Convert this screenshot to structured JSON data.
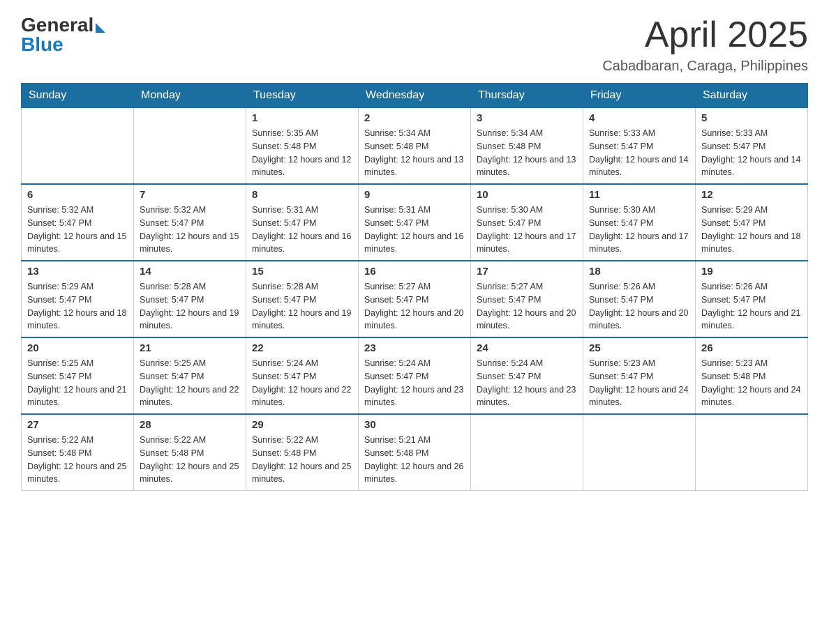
{
  "header": {
    "logo_general": "General",
    "logo_blue": "Blue",
    "month_title": "April 2025",
    "location": "Cabadbaran, Caraga, Philippines"
  },
  "columns": [
    "Sunday",
    "Monday",
    "Tuesday",
    "Wednesday",
    "Thursday",
    "Friday",
    "Saturday"
  ],
  "weeks": [
    [
      {
        "day": "",
        "sunrise": "",
        "sunset": "",
        "daylight": ""
      },
      {
        "day": "",
        "sunrise": "",
        "sunset": "",
        "daylight": ""
      },
      {
        "day": "1",
        "sunrise": "Sunrise: 5:35 AM",
        "sunset": "Sunset: 5:48 PM",
        "daylight": "Daylight: 12 hours and 12 minutes."
      },
      {
        "day": "2",
        "sunrise": "Sunrise: 5:34 AM",
        "sunset": "Sunset: 5:48 PM",
        "daylight": "Daylight: 12 hours and 13 minutes."
      },
      {
        "day": "3",
        "sunrise": "Sunrise: 5:34 AM",
        "sunset": "Sunset: 5:48 PM",
        "daylight": "Daylight: 12 hours and 13 minutes."
      },
      {
        "day": "4",
        "sunrise": "Sunrise: 5:33 AM",
        "sunset": "Sunset: 5:47 PM",
        "daylight": "Daylight: 12 hours and 14 minutes."
      },
      {
        "day": "5",
        "sunrise": "Sunrise: 5:33 AM",
        "sunset": "Sunset: 5:47 PM",
        "daylight": "Daylight: 12 hours and 14 minutes."
      }
    ],
    [
      {
        "day": "6",
        "sunrise": "Sunrise: 5:32 AM",
        "sunset": "Sunset: 5:47 PM",
        "daylight": "Daylight: 12 hours and 15 minutes."
      },
      {
        "day": "7",
        "sunrise": "Sunrise: 5:32 AM",
        "sunset": "Sunset: 5:47 PM",
        "daylight": "Daylight: 12 hours and 15 minutes."
      },
      {
        "day": "8",
        "sunrise": "Sunrise: 5:31 AM",
        "sunset": "Sunset: 5:47 PM",
        "daylight": "Daylight: 12 hours and 16 minutes."
      },
      {
        "day": "9",
        "sunrise": "Sunrise: 5:31 AM",
        "sunset": "Sunset: 5:47 PM",
        "daylight": "Daylight: 12 hours and 16 minutes."
      },
      {
        "day": "10",
        "sunrise": "Sunrise: 5:30 AM",
        "sunset": "Sunset: 5:47 PM",
        "daylight": "Daylight: 12 hours and 17 minutes."
      },
      {
        "day": "11",
        "sunrise": "Sunrise: 5:30 AM",
        "sunset": "Sunset: 5:47 PM",
        "daylight": "Daylight: 12 hours and 17 minutes."
      },
      {
        "day": "12",
        "sunrise": "Sunrise: 5:29 AM",
        "sunset": "Sunset: 5:47 PM",
        "daylight": "Daylight: 12 hours and 18 minutes."
      }
    ],
    [
      {
        "day": "13",
        "sunrise": "Sunrise: 5:29 AM",
        "sunset": "Sunset: 5:47 PM",
        "daylight": "Daylight: 12 hours and 18 minutes."
      },
      {
        "day": "14",
        "sunrise": "Sunrise: 5:28 AM",
        "sunset": "Sunset: 5:47 PM",
        "daylight": "Daylight: 12 hours and 19 minutes."
      },
      {
        "day": "15",
        "sunrise": "Sunrise: 5:28 AM",
        "sunset": "Sunset: 5:47 PM",
        "daylight": "Daylight: 12 hours and 19 minutes."
      },
      {
        "day": "16",
        "sunrise": "Sunrise: 5:27 AM",
        "sunset": "Sunset: 5:47 PM",
        "daylight": "Daylight: 12 hours and 20 minutes."
      },
      {
        "day": "17",
        "sunrise": "Sunrise: 5:27 AM",
        "sunset": "Sunset: 5:47 PM",
        "daylight": "Daylight: 12 hours and 20 minutes."
      },
      {
        "day": "18",
        "sunrise": "Sunrise: 5:26 AM",
        "sunset": "Sunset: 5:47 PM",
        "daylight": "Daylight: 12 hours and 20 minutes."
      },
      {
        "day": "19",
        "sunrise": "Sunrise: 5:26 AM",
        "sunset": "Sunset: 5:47 PM",
        "daylight": "Daylight: 12 hours and 21 minutes."
      }
    ],
    [
      {
        "day": "20",
        "sunrise": "Sunrise: 5:25 AM",
        "sunset": "Sunset: 5:47 PM",
        "daylight": "Daylight: 12 hours and 21 minutes."
      },
      {
        "day": "21",
        "sunrise": "Sunrise: 5:25 AM",
        "sunset": "Sunset: 5:47 PM",
        "daylight": "Daylight: 12 hours and 22 minutes."
      },
      {
        "day": "22",
        "sunrise": "Sunrise: 5:24 AM",
        "sunset": "Sunset: 5:47 PM",
        "daylight": "Daylight: 12 hours and 22 minutes."
      },
      {
        "day": "23",
        "sunrise": "Sunrise: 5:24 AM",
        "sunset": "Sunset: 5:47 PM",
        "daylight": "Daylight: 12 hours and 23 minutes."
      },
      {
        "day": "24",
        "sunrise": "Sunrise: 5:24 AM",
        "sunset": "Sunset: 5:47 PM",
        "daylight": "Daylight: 12 hours and 23 minutes."
      },
      {
        "day": "25",
        "sunrise": "Sunrise: 5:23 AM",
        "sunset": "Sunset: 5:47 PM",
        "daylight": "Daylight: 12 hours and 24 minutes."
      },
      {
        "day": "26",
        "sunrise": "Sunrise: 5:23 AM",
        "sunset": "Sunset: 5:48 PM",
        "daylight": "Daylight: 12 hours and 24 minutes."
      }
    ],
    [
      {
        "day": "27",
        "sunrise": "Sunrise: 5:22 AM",
        "sunset": "Sunset: 5:48 PM",
        "daylight": "Daylight: 12 hours and 25 minutes."
      },
      {
        "day": "28",
        "sunrise": "Sunrise: 5:22 AM",
        "sunset": "Sunset: 5:48 PM",
        "daylight": "Daylight: 12 hours and 25 minutes."
      },
      {
        "day": "29",
        "sunrise": "Sunrise: 5:22 AM",
        "sunset": "Sunset: 5:48 PM",
        "daylight": "Daylight: 12 hours and 25 minutes."
      },
      {
        "day": "30",
        "sunrise": "Sunrise: 5:21 AM",
        "sunset": "Sunset: 5:48 PM",
        "daylight": "Daylight: 12 hours and 26 minutes."
      },
      {
        "day": "",
        "sunrise": "",
        "sunset": "",
        "daylight": ""
      },
      {
        "day": "",
        "sunrise": "",
        "sunset": "",
        "daylight": ""
      },
      {
        "day": "",
        "sunrise": "",
        "sunset": "",
        "daylight": ""
      }
    ]
  ]
}
